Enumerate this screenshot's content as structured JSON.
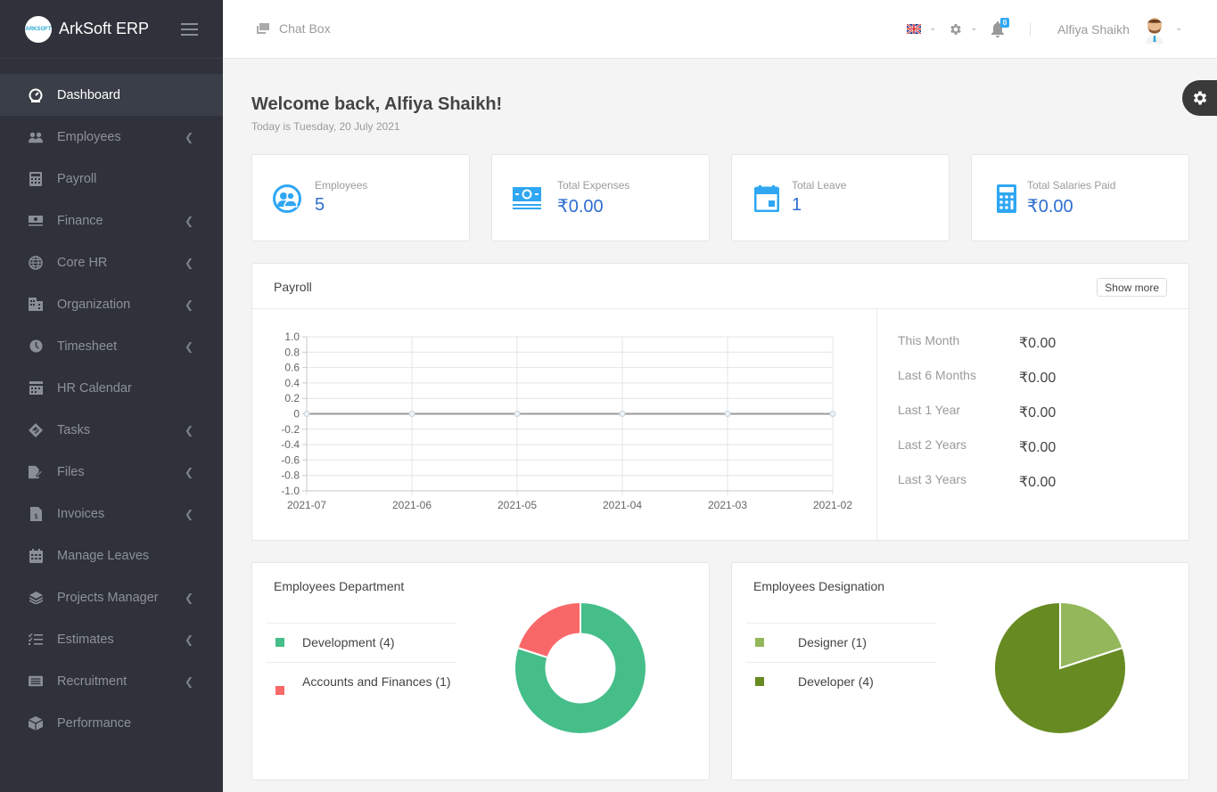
{
  "app": {
    "name": "ArkSoft ERP",
    "logo_text": "ARKSOFT"
  },
  "sidebar": {
    "items": [
      {
        "label": "Dashboard",
        "icon": "dashboard-icon",
        "active": true,
        "has_submenu": false
      },
      {
        "label": "Employees",
        "icon": "users-icon",
        "active": false,
        "has_submenu": true
      },
      {
        "label": "Payroll",
        "icon": "calculator-icon",
        "active": false,
        "has_submenu": false
      },
      {
        "label": "Finance",
        "icon": "money-icon",
        "active": false,
        "has_submenu": true
      },
      {
        "label": "Core HR",
        "icon": "globe-icon",
        "active": false,
        "has_submenu": true
      },
      {
        "label": "Organization",
        "icon": "building-icon",
        "active": false,
        "has_submenu": true
      },
      {
        "label": "Timesheet",
        "icon": "clock-icon",
        "active": false,
        "has_submenu": true
      },
      {
        "label": "HR Calendar",
        "icon": "calendar-icon",
        "active": false,
        "has_submenu": false
      },
      {
        "label": "Tasks",
        "icon": "task-icon",
        "active": false,
        "has_submenu": true
      },
      {
        "label": "Files",
        "icon": "file-edit-icon",
        "active": false,
        "has_submenu": true
      },
      {
        "label": "Invoices",
        "icon": "invoice-icon",
        "active": false,
        "has_submenu": true
      },
      {
        "label": "Manage Leaves",
        "icon": "calendar-grid-icon",
        "active": false,
        "has_submenu": false
      },
      {
        "label": "Projects Manager",
        "icon": "layers-icon",
        "active": false,
        "has_submenu": true
      },
      {
        "label": "Estimates",
        "icon": "checklist-icon",
        "active": false,
        "has_submenu": true
      },
      {
        "label": "Recruitment",
        "icon": "newspaper-icon",
        "active": false,
        "has_submenu": true
      },
      {
        "label": "Performance",
        "icon": "cube-icon",
        "active": false,
        "has_submenu": false
      }
    ]
  },
  "header": {
    "chat_label": "Chat Box",
    "notification_count": "0",
    "user_name": "Alfiya Shaikh",
    "language": "English (UK flag)"
  },
  "main": {
    "welcome": "Welcome back, Alfiya Shaikh!",
    "today": "Today is Tuesday, 20 July 2021",
    "stats": [
      {
        "label": "Employees",
        "value": "5",
        "icon": "users-circle-icon"
      },
      {
        "label": "Total Expenses",
        "value": "₹0.00",
        "icon": "money-stack-icon"
      },
      {
        "label": "Total Leave",
        "value": "1",
        "icon": "calendar-icon"
      },
      {
        "label": "Total Salaries Paid",
        "value": "₹0.00",
        "icon": "calculator-icon"
      }
    ],
    "payroll": {
      "title": "Payroll",
      "show_more": "Show more",
      "summary": [
        {
          "label": "This Month",
          "value": "₹0.00"
        },
        {
          "label": "Last 6 Months",
          "value": "₹0.00"
        },
        {
          "label": "Last 1 Year",
          "value": "₹0.00"
        },
        {
          "label": "Last 2 Years",
          "value": "₹0.00"
        },
        {
          "label": "Last 3 Years",
          "value": "₹0.00"
        }
      ]
    },
    "department": {
      "title": "Employees Department",
      "legend": [
        {
          "label": "Development (4)",
          "color": "#46be8a"
        },
        {
          "label": "Accounts and Finances (1)",
          "color": "#f96868"
        }
      ]
    },
    "designation": {
      "title": "Employees Designation",
      "legend": [
        {
          "label": "Designer (1)",
          "color": "#93b75a"
        },
        {
          "label": "Developer (4)",
          "color": "#678b22"
        }
      ]
    }
  },
  "chart_data": [
    {
      "type": "line",
      "title": "Payroll",
      "x": [
        "2021-07",
        "2021-06",
        "2021-05",
        "2021-04",
        "2021-03",
        "2021-02"
      ],
      "series": [
        {
          "name": "Payroll",
          "values": [
            0,
            0,
            0,
            0,
            0,
            0
          ]
        }
      ],
      "ylim": [
        -1.0,
        1.0
      ],
      "yticks": [
        "1.0",
        "0.8",
        "0.6",
        "0.4",
        "0.2",
        "0",
        "-0.2",
        "-0.4",
        "-0.6",
        "-0.8",
        "-1.0"
      ],
      "grid": true,
      "xlabel": "",
      "ylabel": ""
    },
    {
      "type": "pie",
      "variant": "doughnut",
      "title": "Employees Department",
      "categories": [
        "Development",
        "Accounts and Finances"
      ],
      "values": [
        4,
        1
      ],
      "colors": [
        "#46be8a",
        "#f96868"
      ]
    },
    {
      "type": "pie",
      "title": "Employees Designation",
      "categories": [
        "Designer",
        "Developer"
      ],
      "values": [
        1,
        4
      ],
      "colors": [
        "#93b75a",
        "#678b22"
      ]
    }
  ]
}
